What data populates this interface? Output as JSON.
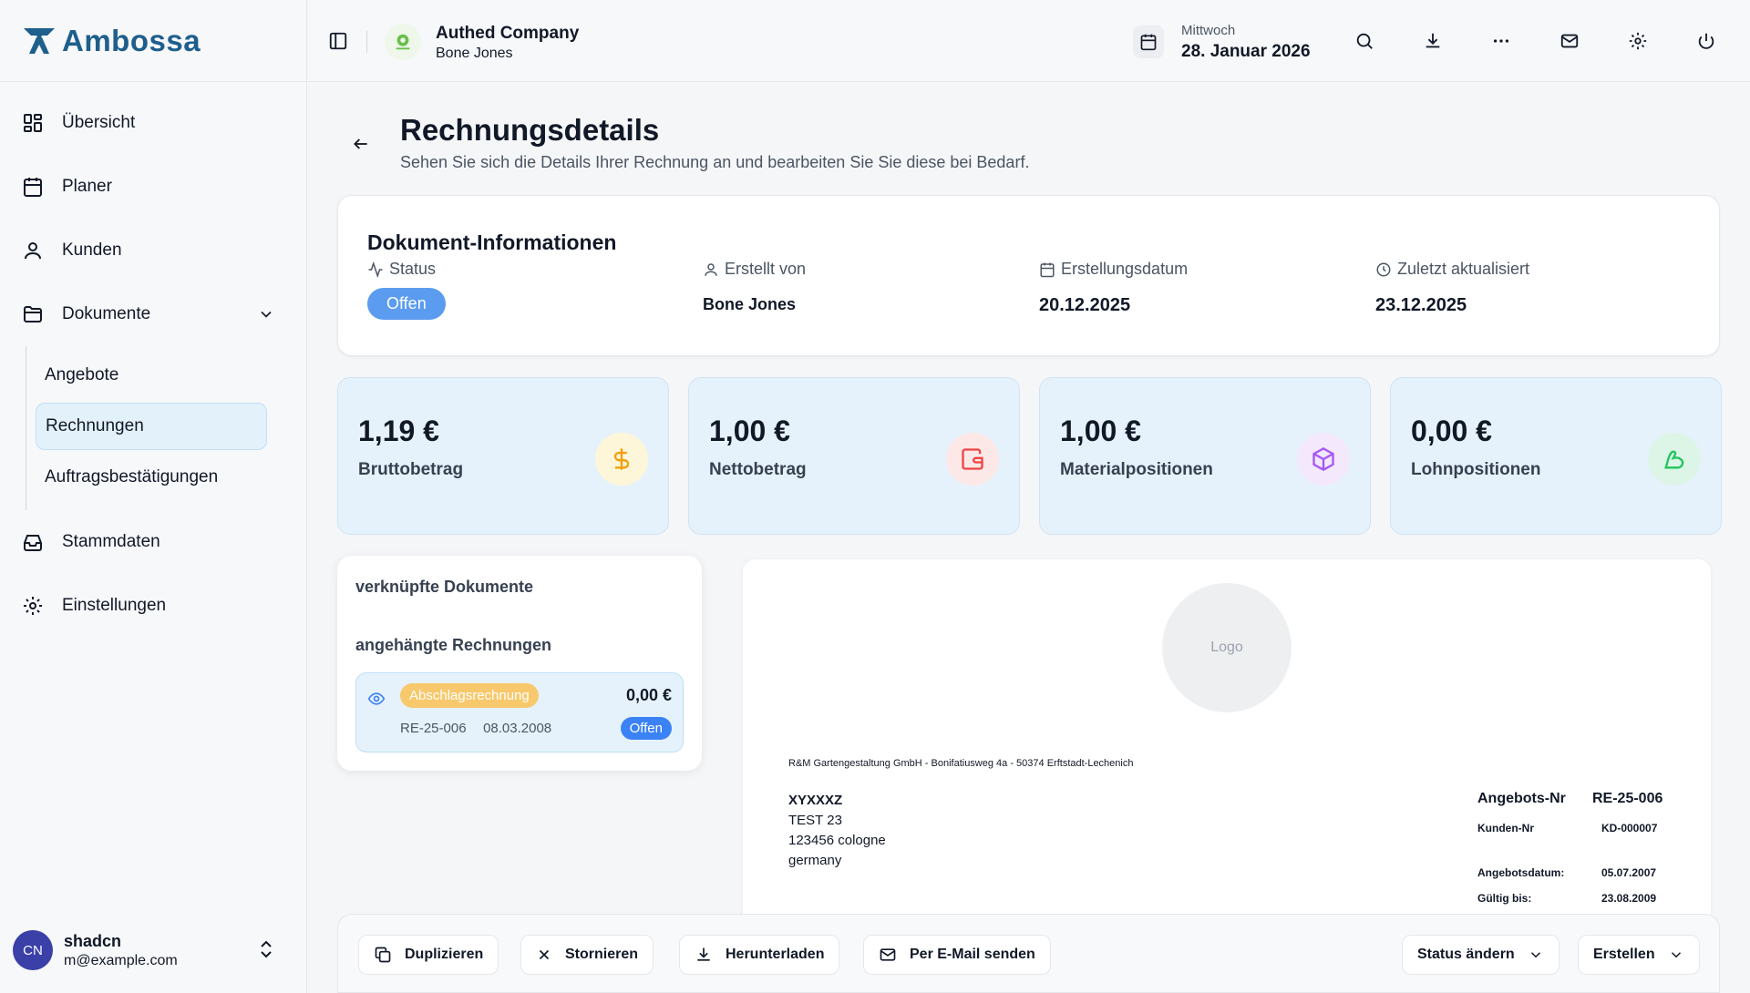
{
  "brand": {
    "name": "Ambossa",
    "color": "#1e5f8c"
  },
  "sidebar": {
    "items": [
      {
        "label": "Übersicht",
        "icon": "grid-icon"
      },
      {
        "label": "Planer",
        "icon": "calendar-icon"
      },
      {
        "label": "Kunden",
        "icon": "user-icon"
      },
      {
        "label": "Dokumente",
        "icon": "folder-icon"
      },
      {
        "label": "Stammdaten",
        "icon": "inbox-icon"
      },
      {
        "label": "Einstellungen",
        "icon": "gear-icon"
      }
    ],
    "sub_items": [
      "Angebote",
      "Rechnungen",
      "Auftragsbestätigungen"
    ],
    "active_sub": "Rechnungen"
  },
  "user": {
    "initials": "CN",
    "name": "shadcn",
    "email": "m@example.com"
  },
  "header": {
    "company": "Authed Company",
    "company_user": "Bone Jones",
    "weekday": "Mittwoch",
    "date": "28. Januar 2026"
  },
  "page": {
    "title": "Rechnungsdetails",
    "subtitle": "Sehen Sie sich die Details Ihrer Rechnung an und bearbeiten Sie Sie diese bei Bedarf."
  },
  "doc_info": {
    "title": "Dokument-Informationen",
    "status_label": "Status",
    "status": "Offen",
    "created_by_label": "Erstellt von",
    "created_by": "Bone Jones",
    "created_date_label": "Erstellungsdatum",
    "created_date": "20.12.2025",
    "updated_label": "Zuletzt aktualisiert",
    "updated": "23.12.2025"
  },
  "stats": [
    {
      "value": "1,19 €",
      "label": "Bruttobetrag",
      "icon": "dollar-icon",
      "color": "#f59e0b",
      "bg": "#fdf6d8"
    },
    {
      "value": "1,00 €",
      "label": "Nettobetrag",
      "icon": "wallet-icon",
      "color": "#ef4444",
      "bg": "#fde8e8"
    },
    {
      "value": "1,00 €",
      "label": "Materialpositionen",
      "icon": "package-icon",
      "color": "#a855f7",
      "bg": "#f3e8fc"
    },
    {
      "value": "0,00 €",
      "label": "Lohnpositionen",
      "icon": "muscle-icon",
      "color": "#22c55e",
      "bg": "#dcf5e6"
    }
  ],
  "linked": {
    "title": "verknüpfte Dokumente",
    "subtitle": "angehängte Rechnungen",
    "row": {
      "type": "Abschlagsrechnung",
      "amount": "0,00 €",
      "number": "RE-25-006",
      "date": "08.03.2008",
      "status": "Offen"
    }
  },
  "preview": {
    "logo_text": "Logo",
    "sender": "R&M Gartengestaltung GmbH - Bonifatiusweg 4a - 50374 Erftstadt-Lechenich",
    "recipient": [
      "XYXXXZ",
      "TEST 23",
      "123456 cologne",
      "germany"
    ],
    "meta": {
      "offer_nr_label": "Angebots-Nr",
      "offer_nr": "RE-25-006",
      "customer_nr_label": "Kunden-Nr",
      "customer_nr": "KD-000007",
      "offer_date_label": "Angebotsdatum:",
      "offer_date": "05.07.2007",
      "valid_label": "Gültig bis:",
      "valid": "23.08.2009"
    }
  },
  "actions": {
    "duplicate": "Duplizieren",
    "cancel": "Stornieren",
    "download": "Herunterladen",
    "email": "Per E-Mail senden",
    "change_status": "Status ändern",
    "create": "Erstellen"
  }
}
